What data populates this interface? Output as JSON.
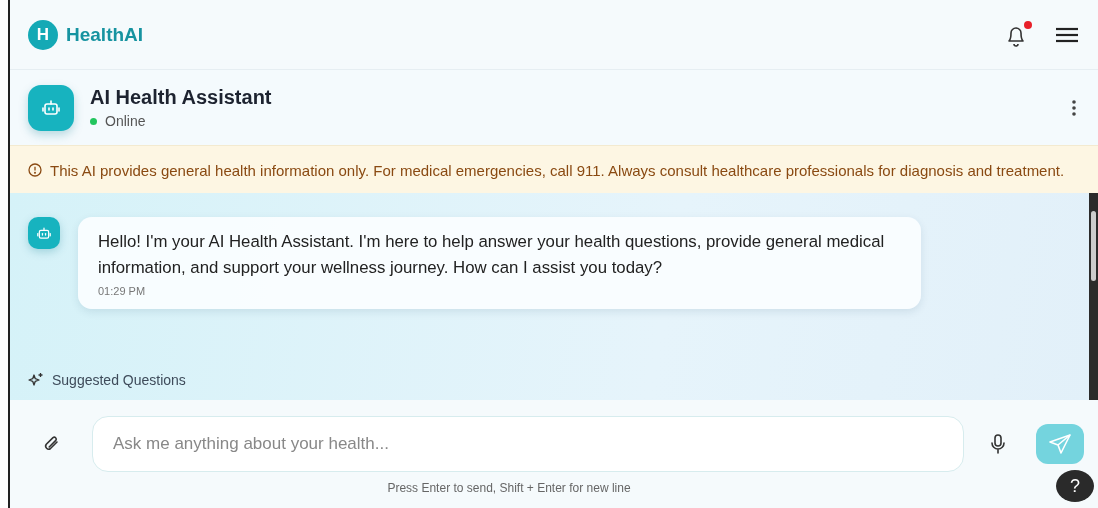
{
  "header": {
    "logo_letter": "H",
    "brand": "HealthAI",
    "notifications": {
      "unread": true
    }
  },
  "assistant": {
    "name": "AI Health Assistant",
    "status": "Online",
    "online": true
  },
  "disclaimer": "This AI provides general health information only. For medical emergencies, call 911. Always consult healthcare professionals for diagnosis and treatment.",
  "messages": [
    {
      "kind": "assistant",
      "text": "Hello! I'm your AI Health Assistant. I'm here to help answer your health questions, provide general medical information, and support your wellness journey. How can I assist you today?",
      "time": "01:29 PM"
    }
  ],
  "suggested_heading": "Suggested Questions",
  "composer": {
    "placeholder": "Ask me anything about your health...",
    "hint": "Press Enter to send, Shift + Enter for new line"
  },
  "help_button": "?"
}
